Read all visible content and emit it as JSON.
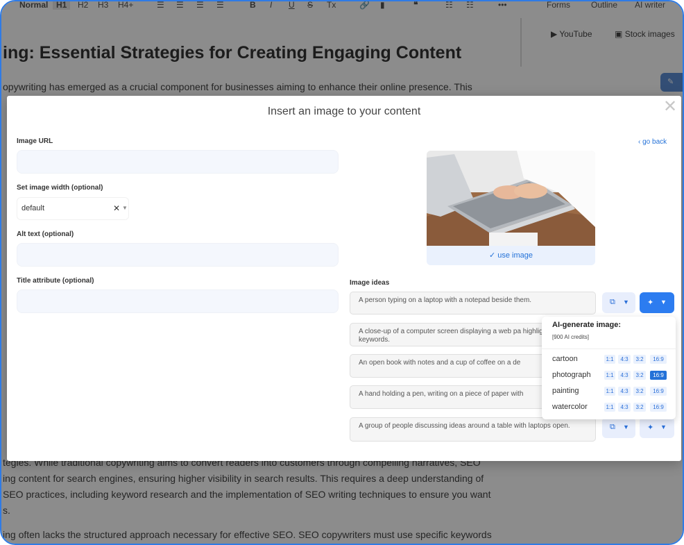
{
  "toolbar": {
    "style_normal": "Normal",
    "h1": "H1",
    "h2": "H2",
    "h3": "H3",
    "h4": "H4+",
    "bold": "B",
    "italic": "I",
    "underline": "U",
    "strike": "S",
    "clear": "Tx",
    "more": "•••",
    "forms": "Forms",
    "outline": "Outline",
    "ai_writer": "AI writer"
  },
  "sidebar_tabs": {
    "youtube": "YouTube",
    "stock_images": "Stock images"
  },
  "background": {
    "title": "ing: Essential Strategies for Creating Engaging Content",
    "para1": "opywriting has emerged as a crucial component for businesses aiming to enhance their online presence. This",
    "para2": "tegies. While traditional copywriting aims to convert readers into customers through compelling narratives, SEO",
    "para3": "ing content for search engines, ensuring higher visibility in search results. This requires a deep understanding of",
    "para4": "SEO practices, including keyword research and the implementation of SEO writing techniques to ensure you want",
    "para5": "s.",
    "para6": "ing often lacks the structured approach necessary for effective SEO. SEO copywriters must use specific keywords"
  },
  "modal": {
    "title": "Insert an image to your content",
    "image_url_label": "Image URL",
    "image_url_value": "",
    "width_label": "Set image width (optional)",
    "width_value": "default",
    "alt_label": "Alt text (optional)",
    "alt_value": "",
    "title_attr_label": "Title attribute (optional)",
    "title_attr_value": "",
    "go_back": "go back",
    "use_image": "use image",
    "ideas_label": "Image ideas",
    "ideas": [
      "A person typing on a laptop with a notepad beside them.",
      "A close-up of a computer screen displaying a web pa highlighted keywords.",
      "An open book with notes and a cup of coffee on a de",
      "A hand holding a pen, writing on a piece of paper with",
      "A group of people discussing ideas around a table with laptops open."
    ]
  },
  "ai_menu": {
    "title": "AI-generate image:",
    "credits": "[900 AI credits]",
    "ratios": [
      "1:1",
      "4:3",
      "3:2",
      "16:9"
    ],
    "styles": [
      "cartoon",
      "photograph",
      "painting",
      "watercolor"
    ],
    "selected": {
      "style": "photograph",
      "ratio": "16:9"
    }
  },
  "colors": {
    "accent": "#2472d8",
    "button_primary": "#2c7cf0",
    "frame_border": "#2f7be5",
    "field_bg": "#f4f7fd"
  }
}
